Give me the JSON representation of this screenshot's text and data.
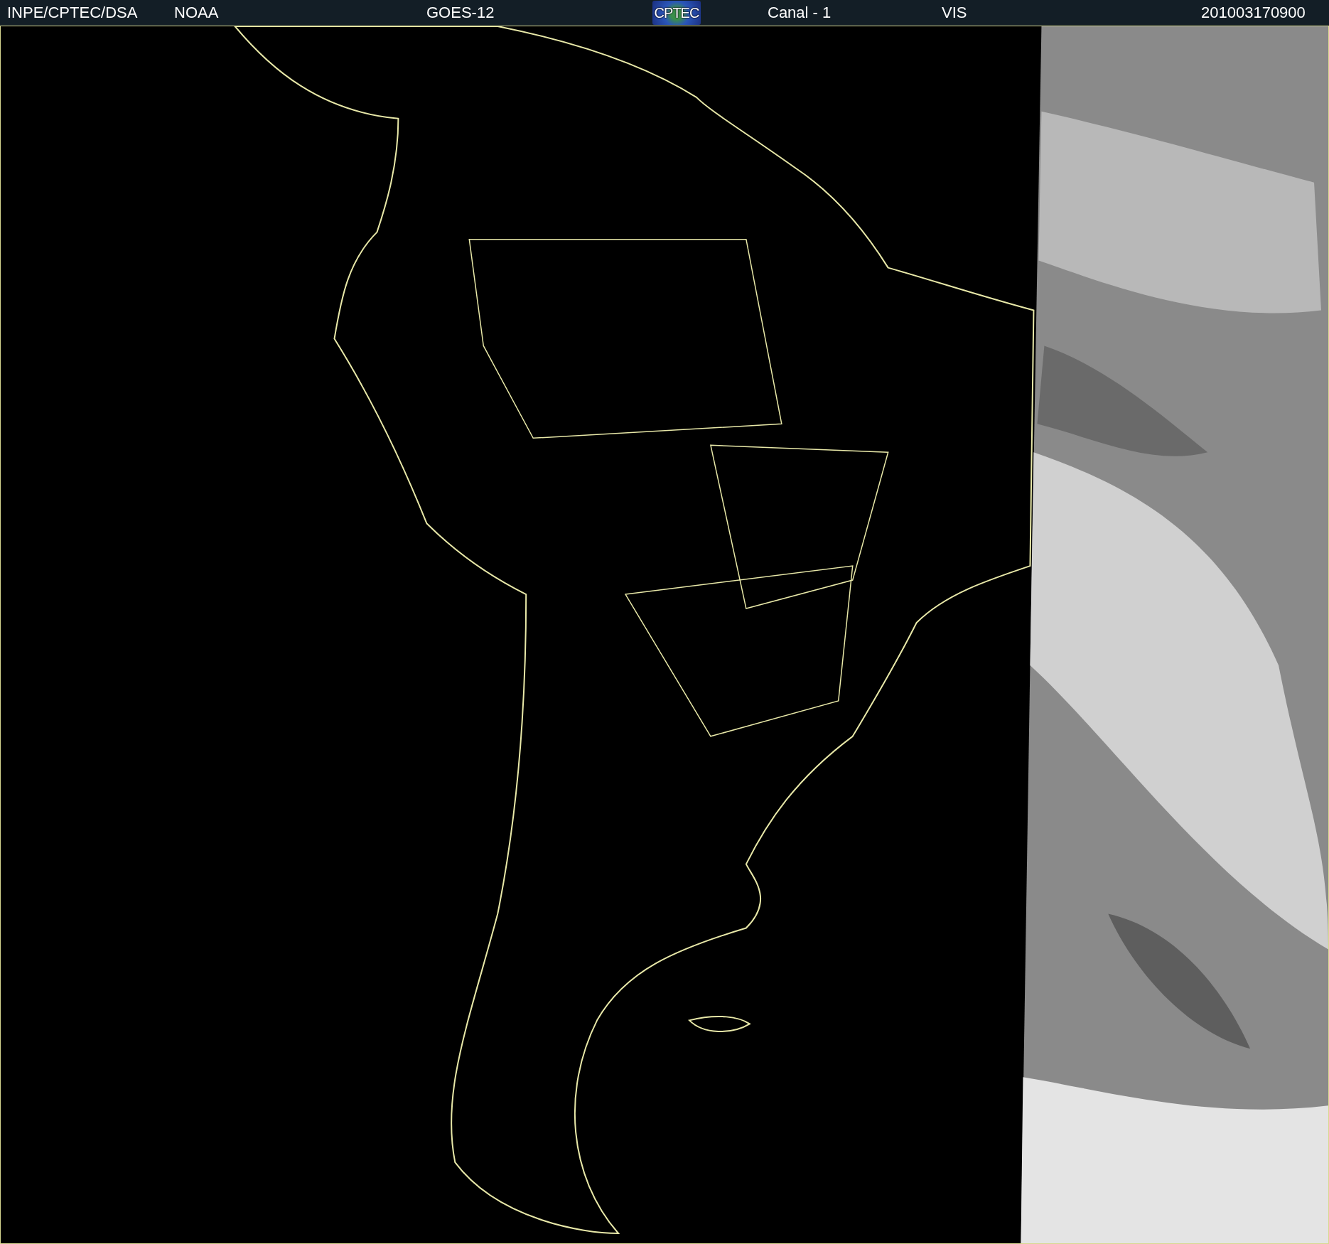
{
  "header": {
    "source": "INPE/CPTEC/DSA",
    "agency": "NOAA",
    "satellite": "GOES-12",
    "logo_text": "CPTEC",
    "channel": "Canal - 1",
    "band": "VIS",
    "timestamp": "201003170900"
  }
}
